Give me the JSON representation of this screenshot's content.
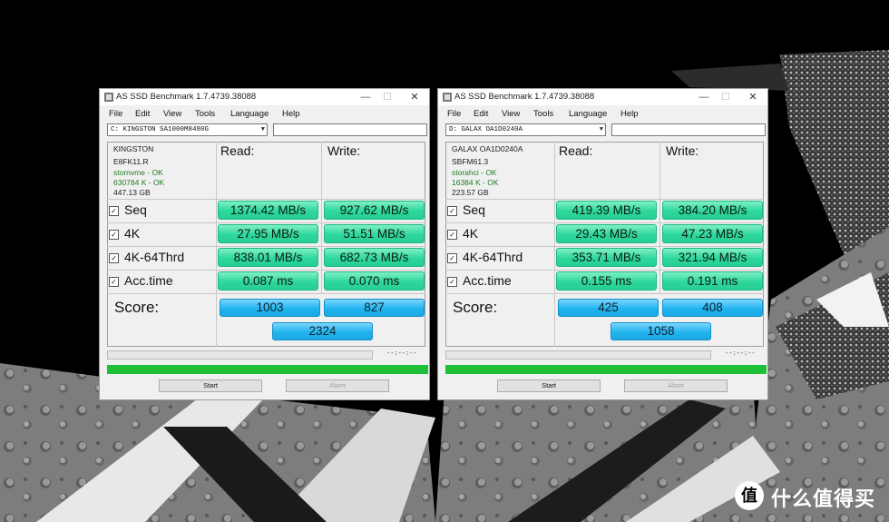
{
  "windows": [
    {
      "title": "AS SSD Benchmark 1.7.4739.38088",
      "menu": [
        "File",
        "Edit",
        "View",
        "Tools",
        "Language",
        "Help"
      ],
      "drive": "C: KINGSTON SA1000M8480G",
      "info": [
        "KINGSTON",
        "E8FK11.R",
        "stornvme - OK",
        "630784 K - OK",
        "447.13 GB"
      ],
      "read_label": "Read:",
      "write_label": "Write:",
      "rows": [
        {
          "label": "Seq",
          "read": "1374.42 MB/s",
          "write": "927.62 MB/s"
        },
        {
          "label": "4K",
          "read": "27.95 MB/s",
          "write": "51.51 MB/s"
        },
        {
          "label": "4K-64Thrd",
          "read": "838.01 MB/s",
          "write": "682.73 MB/s"
        },
        {
          "label": "Acc.time",
          "read": "0.087 ms",
          "write": "0.070 ms"
        }
      ],
      "score_label": "Score:",
      "score_read": "1003",
      "score_write": "827",
      "score_total": "2324",
      "time": "--:--:--",
      "start": "Start",
      "abort": "Abort"
    },
    {
      "title": "AS SSD Benchmark 1.7.4739.38088",
      "menu": [
        "File",
        "Edit",
        "View",
        "Tools",
        "Language",
        "Help"
      ],
      "drive": "D: GALAX OA1D0240A",
      "info": [
        "GALAX OA1D0240A",
        "SBFM61.3",
        "storahci - OK",
        "16384 K - OK",
        "223.57 GB"
      ],
      "read_label": "Read:",
      "write_label": "Write:",
      "rows": [
        {
          "label": "Seq",
          "read": "419.39 MB/s",
          "write": "384.20 MB/s"
        },
        {
          "label": "4K",
          "read": "29.43 MB/s",
          "write": "47.23 MB/s"
        },
        {
          "label": "4K-64Thrd",
          "read": "353.71 MB/s",
          "write": "321.94 MB/s"
        },
        {
          "label": "Acc.time",
          "read": "0.155 ms",
          "write": "0.191 ms"
        }
      ],
      "score_label": "Score:",
      "score_read": "425",
      "score_write": "408",
      "score_total": "1058",
      "time": "--:--:--",
      "start": "Start",
      "abort": "Abort"
    }
  ],
  "watermark": {
    "logo": "值",
    "text": "什么值得买"
  },
  "colors": {
    "value_green": "#2ed79c",
    "score_blue": "#22b4ee",
    "progress_green": "#1ec037"
  }
}
